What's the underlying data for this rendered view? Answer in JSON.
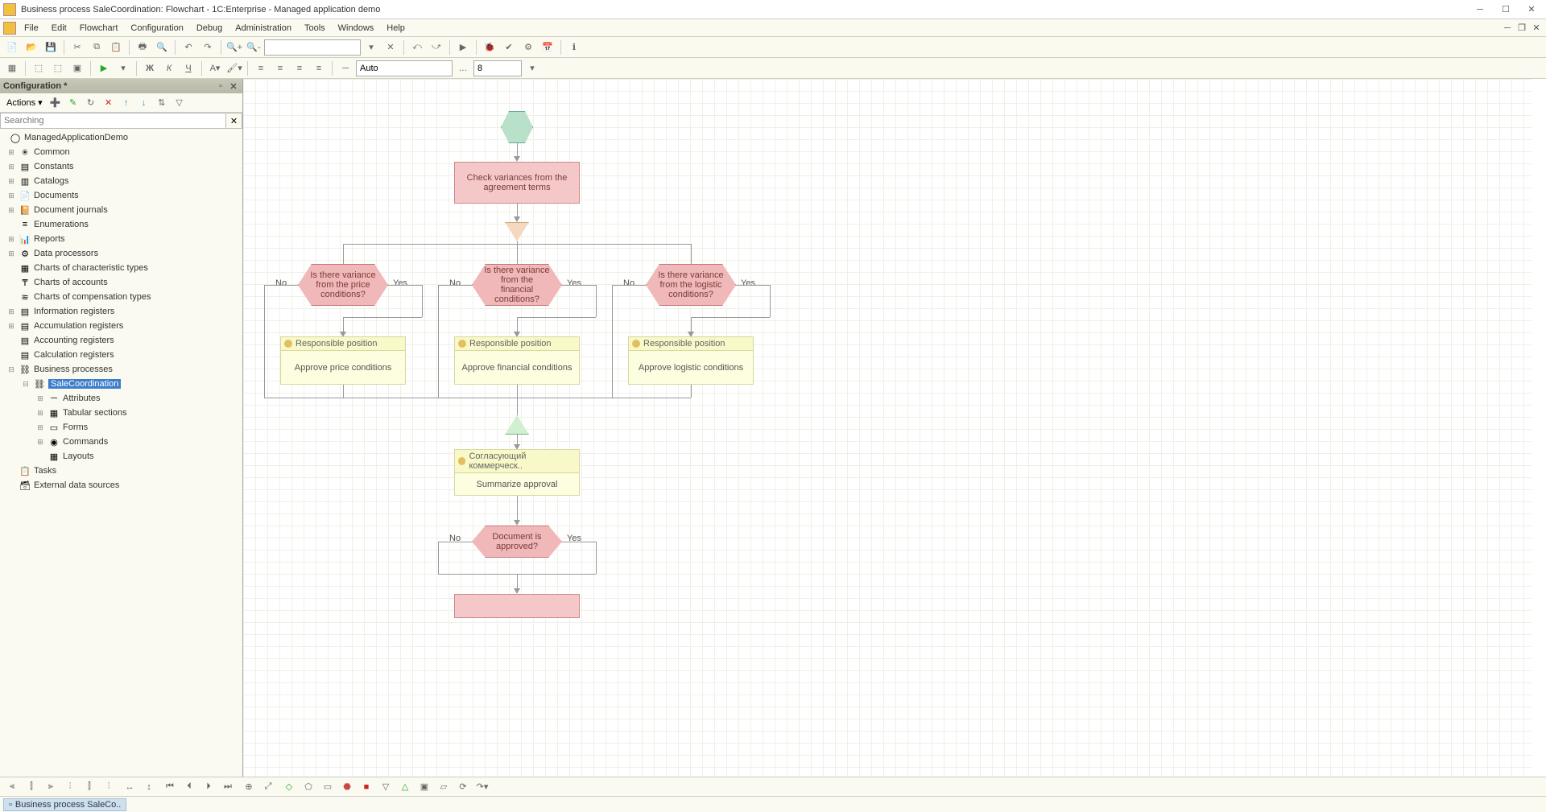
{
  "window": {
    "title": "Business process SaleCoordination: Flowchart - 1C:Enterprise - Managed application demo"
  },
  "menu": {
    "items": [
      "File",
      "Edit",
      "Flowchart",
      "Configuration",
      "Debug",
      "Administration",
      "Tools",
      "Windows",
      "Help"
    ]
  },
  "toolbar2": {
    "line_width_combo": "Auto",
    "font_size": "8"
  },
  "config_panel": {
    "title": "Configuration *",
    "actions_label": "Actions",
    "search_placeholder": "Searching",
    "tree": {
      "root": "ManagedApplicationDemo",
      "items": [
        "Common",
        "Constants",
        "Catalogs",
        "Documents",
        "Document journals",
        "Enumerations",
        "Reports",
        "Data processors",
        "Charts of characteristic types",
        "Charts of accounts",
        "Charts of compensation types",
        "Information registers",
        "Accumulation registers",
        "Accounting registers",
        "Calculation registers",
        "Business processes"
      ],
      "bp_selected": "SaleCoordination",
      "bp_children": [
        "Attributes",
        "Tabular sections",
        "Forms",
        "Commands",
        "Layouts"
      ],
      "tail_items": [
        "Tasks",
        "External data sources"
      ]
    }
  },
  "flowchart": {
    "process1": "Check variances from the agreement terms",
    "dec1": "Is there variance from the price conditions?",
    "dec2": "Is there variance from the financial conditions?",
    "dec3": "Is there variance from the logistic conditions?",
    "no": "No",
    "yes": "Yes",
    "resp": "Responsible position",
    "task1": "Approve price conditions",
    "task2": "Approve financial conditions",
    "task3": "Approve logistic conditions",
    "consolidator": "Согласующий коммерческ..",
    "summarize": "Summarize approval",
    "dec4": "Document is approved?"
  },
  "statusbar": {
    "tab": "Business process SaleCo.."
  }
}
